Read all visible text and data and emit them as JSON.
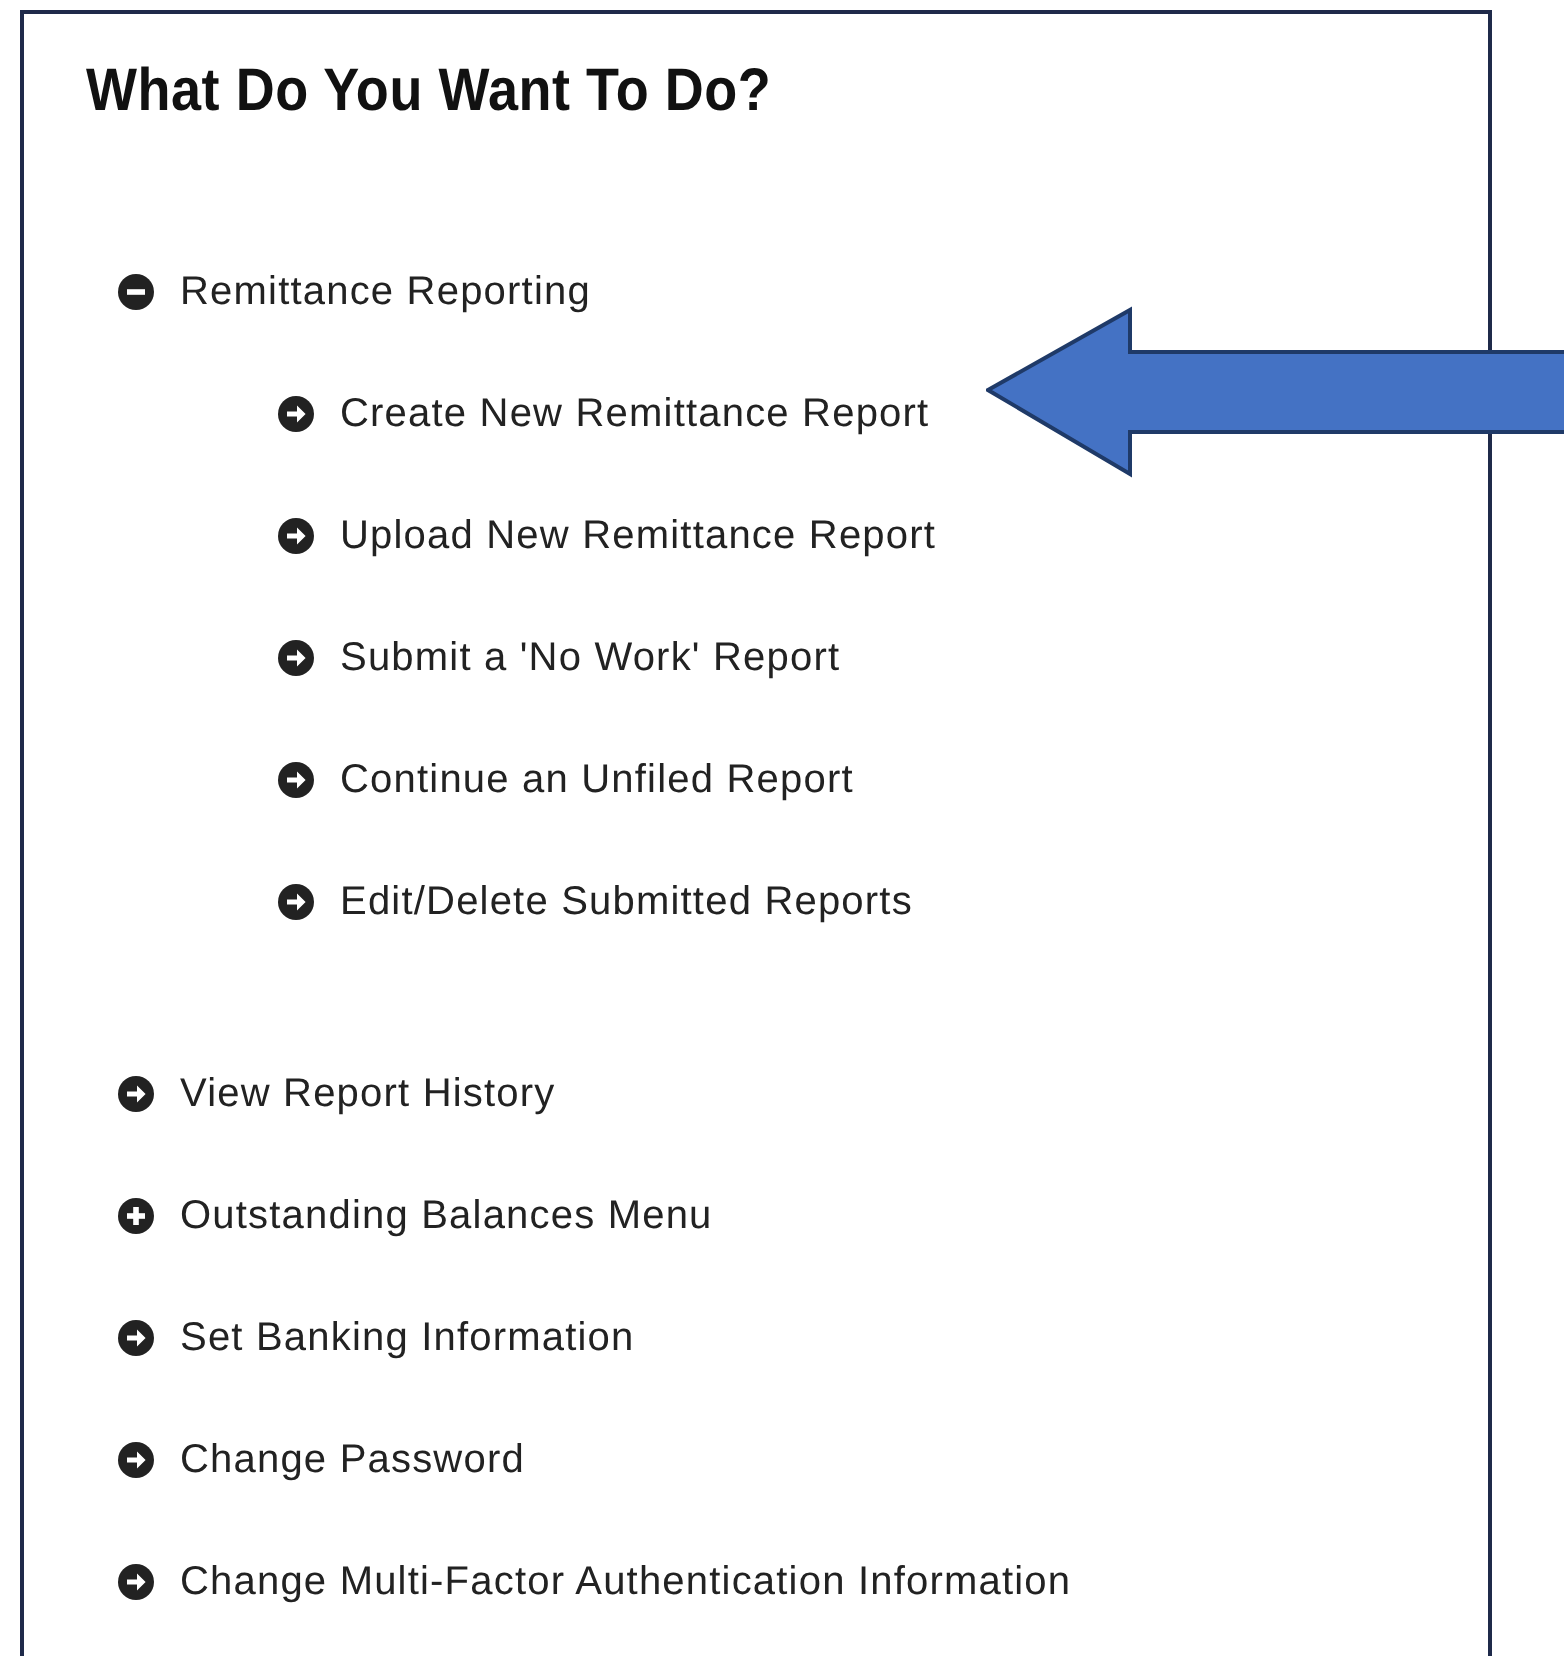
{
  "title": "What Do You Want To Do?",
  "items": [
    {
      "kind": "group",
      "label": "Remittance Reporting",
      "expanded": true,
      "children": [
        {
          "kind": "link",
          "label": "Create New Remittance Report"
        },
        {
          "kind": "link",
          "label": "Upload New Remittance Report"
        },
        {
          "kind": "link",
          "label": "Submit a 'No Work' Report"
        },
        {
          "kind": "link",
          "label": "Continue an Unfiled Report"
        },
        {
          "kind": "link",
          "label": "Edit/Delete Submitted Reports"
        }
      ]
    },
    {
      "kind": "link",
      "label": "View Report History"
    },
    {
      "kind": "group",
      "label": "Outstanding Balances Menu",
      "expanded": false
    },
    {
      "kind": "link",
      "label": "Set Banking Information"
    },
    {
      "kind": "link",
      "label": "Change Password"
    },
    {
      "kind": "link",
      "label": "Change Multi-Factor Authentication Information"
    }
  ]
}
